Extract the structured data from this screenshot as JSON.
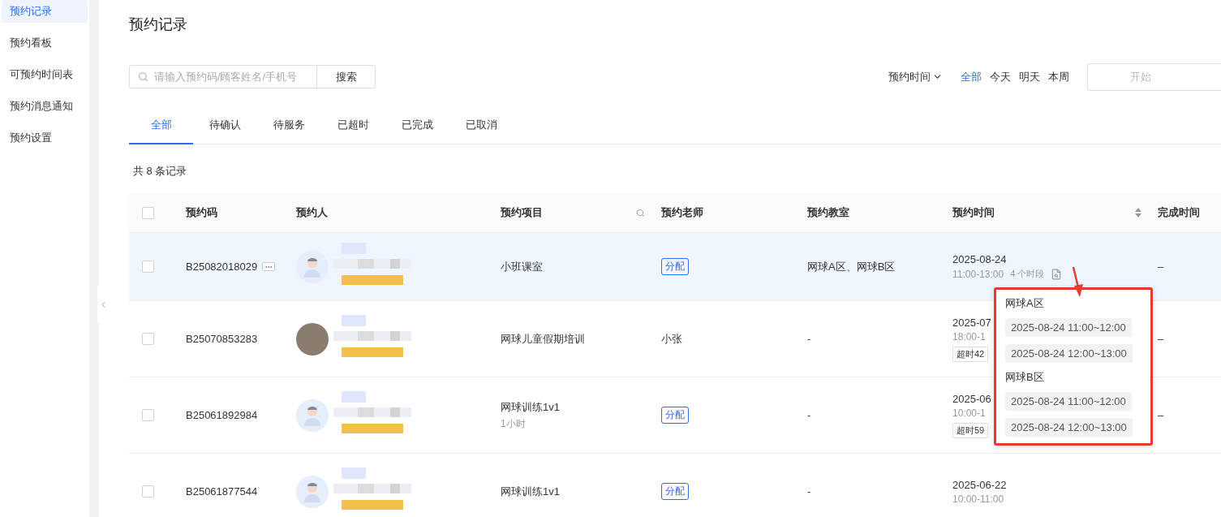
{
  "sidebar": {
    "items": [
      {
        "label": "预约记录",
        "selected": true
      },
      {
        "label": "预约看板",
        "selected": false
      },
      {
        "label": "可预约时间表",
        "selected": false
      },
      {
        "label": "预约消息通知",
        "selected": false
      },
      {
        "label": "预约设置",
        "selected": false
      }
    ]
  },
  "page_title": "预约记录",
  "search": {
    "placeholder": "请输入预约码/顾客姓名/手机号",
    "button": "搜索"
  },
  "time_filter": {
    "label": "预约时间",
    "options": [
      {
        "label": "全部",
        "selected": true
      },
      {
        "label": "今天",
        "selected": false
      },
      {
        "label": "明天",
        "selected": false
      },
      {
        "label": "本周",
        "selected": false
      }
    ],
    "start_placeholder": "开始"
  },
  "tabs": [
    {
      "label": "全部",
      "selected": true
    },
    {
      "label": "待确认",
      "selected": false
    },
    {
      "label": "待服务",
      "selected": false
    },
    {
      "label": "已超时",
      "selected": false
    },
    {
      "label": "已完成",
      "selected": false
    },
    {
      "label": "已取消",
      "selected": false
    }
  ],
  "total": "共 8 条记录",
  "table": {
    "select_all_checked": false,
    "columns": [
      "预约码",
      "预约人",
      "预约项目",
      "预约老师",
      "预约教室",
      "预约时间",
      "完成时间"
    ],
    "rows": [
      {
        "checked": false,
        "highlighted": true,
        "code": "B25082018029",
        "has_more": true,
        "avatar": {
          "kind": "default"
        },
        "project": "小班课室",
        "teacher": {
          "kind": "assign",
          "text": "分配"
        },
        "classroom": "网球A区、网球B区",
        "date": "2025-08-24",
        "time": "11:00-13:00",
        "slots": "4 个时段",
        "completed": "–"
      },
      {
        "checked": false,
        "highlighted": false,
        "code": "B25070853283",
        "has_more": false,
        "avatar": {
          "kind": "photo"
        },
        "project": "网球儿童假期培训",
        "teacher": {
          "kind": "name",
          "text": "小张"
        },
        "classroom": "-",
        "date": "2025-07",
        "time": "18:00-1",
        "overdue": "超时42",
        "completed": "–"
      },
      {
        "checked": false,
        "highlighted": false,
        "code": "B25061892984",
        "has_more": false,
        "avatar": {
          "kind": "default"
        },
        "project": "网球训练1v1",
        "project_sub": "1小时",
        "teacher": {
          "kind": "assign",
          "text": "分配"
        },
        "classroom": "-",
        "date": "2025-06",
        "time": "10:00-1",
        "overdue": "超时59",
        "completed": "–"
      },
      {
        "checked": false,
        "highlighted": false,
        "code": "B25061877544",
        "has_more": false,
        "avatar": {
          "kind": "default"
        },
        "project": "网球训练1v1",
        "teacher": {
          "kind": "assign",
          "text": "分配"
        },
        "classroom": "-",
        "date": "2025-06-22",
        "time": "10:00-11:00"
      }
    ]
  },
  "popover": {
    "groups": [
      {
        "title": "网球A区",
        "slots": [
          "2025-08-24 11:00~12:00",
          "2025-08-24 12:00~13:00"
        ]
      },
      {
        "title": "网球B区",
        "slots": [
          "2025-08-24 11:00~12:00",
          "2025-08-24 12:00~13:00"
        ]
      }
    ]
  }
}
